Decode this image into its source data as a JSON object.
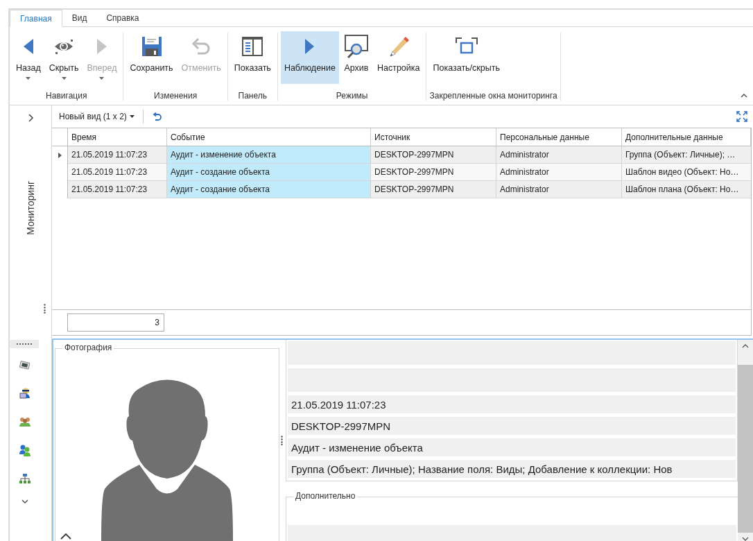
{
  "tabs": [
    {
      "label": "Главная",
      "selected": true
    },
    {
      "label": "Вид",
      "selected": false
    },
    {
      "label": "Справка",
      "selected": false
    }
  ],
  "ribbon": {
    "groups": [
      {
        "label": "Навигация",
        "buttons": [
          {
            "kind": "back",
            "label": "Назад",
            "dropdown": true,
            "disabled": false,
            "selected": false
          },
          {
            "kind": "eye",
            "label": "Скрыть",
            "dropdown": true,
            "disabled": false,
            "selected": false
          },
          {
            "kind": "forward",
            "label": "Вперед",
            "dropdown": true,
            "disabled": true,
            "selected": false
          }
        ]
      },
      {
        "label": "Изменения",
        "buttons": [
          {
            "kind": "save",
            "label": "Сохранить",
            "dropdown": false,
            "disabled": false,
            "selected": false
          },
          {
            "kind": "undo",
            "label": "Отменить",
            "dropdown": false,
            "disabled": true,
            "selected": false
          }
        ]
      },
      {
        "label": "Панель",
        "buttons": [
          {
            "kind": "panel",
            "label": "Показать",
            "dropdown": false,
            "disabled": false,
            "selected": false
          }
        ]
      },
      {
        "label": "Режимы",
        "buttons": [
          {
            "kind": "play",
            "label": "Наблюдение",
            "dropdown": false,
            "disabled": false,
            "selected": true
          },
          {
            "kind": "archive",
            "label": "Архив",
            "dropdown": false,
            "disabled": false,
            "selected": false
          },
          {
            "kind": "pencil",
            "label": "Настройка",
            "dropdown": false,
            "disabled": false,
            "selected": false
          }
        ]
      },
      {
        "label": "Закрепленные окна мониторинга",
        "buttons": [
          {
            "kind": "windows",
            "label": "Показать/скрыть",
            "dropdown": false,
            "disabled": false,
            "selected": false
          }
        ]
      }
    ]
  },
  "sidebar": {
    "title": "Мониторинг"
  },
  "toolbar": {
    "view": "Новый вид (1 x 2)"
  },
  "table": {
    "columns": [
      "Время",
      "Событие",
      "Источник",
      "Персональные данные",
      "Дополнительные данные"
    ],
    "rows": [
      {
        "focused": true,
        "cells": [
          "21.05.2019 11:07:23",
          "Аудит - изменение объекта",
          "DESKTOP-2997MPN",
          "Administrator",
          "Группа (Объект: Личные); …"
        ]
      },
      {
        "focused": false,
        "cells": [
          "21.05.2019 11:07:23",
          "Аудит - создание объекта",
          "DESKTOP-2997MPN",
          "Administrator",
          "Шаблон видео (Объект: Но…"
        ]
      },
      {
        "focused": false,
        "cells": [
          "21.05.2019 11:07:23",
          "Аудит - создание объекта",
          "DESKTOP-2997MPN",
          "Administrator",
          "Шаблон плана (Объект: Но…"
        ]
      }
    ]
  },
  "footer": {
    "count": "3"
  },
  "details": {
    "photo_label": "Фотография",
    "fields": [
      "21.05.2019 11:07:23",
      "DESKTOP-2997MPN",
      "Аудит - изменение объекта",
      "Группа (Объект: Личные); Название поля: Виды; Добавление к коллекции: Нов"
    ],
    "extra_label": "Дополнительно"
  }
}
